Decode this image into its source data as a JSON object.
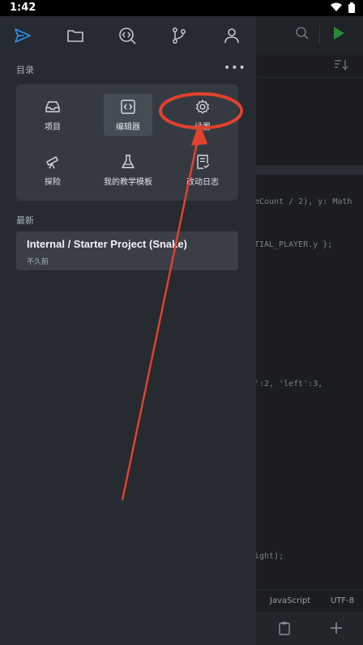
{
  "status_bar": {
    "time": "1:42"
  },
  "drawer": {
    "nav": [
      "send-icon",
      "folder-icon",
      "search-code-icon",
      "branch-icon",
      "user-icon"
    ],
    "section_title": "目录",
    "more_label": "•••",
    "menu": [
      {
        "label": "项目",
        "icon": "inbox-icon"
      },
      {
        "label": "编辑器",
        "icon": "code-icon",
        "active": true
      },
      {
        "label": "设置",
        "icon": "gear-icon"
      },
      {
        "label": "探险",
        "icon": "telescope-icon"
      },
      {
        "label": "我的教学模板",
        "icon": "flask-icon"
      },
      {
        "label": "改动日志",
        "icon": "changelog-icon"
      }
    ],
    "recent_title": "最新",
    "recent": {
      "name": "Internal / Starter Project (Snake)",
      "time": "不久前"
    }
  },
  "editor": {
    "code_lines": [
      "eCount / 2), y: Math",
      "TIAL_PLAYER.y };",
      "':2, 'left':3,",
      "ight);"
    ],
    "status_language": "JavaScript",
    "status_encoding": "UTF-8"
  },
  "colors": {
    "accent": "#2f8df5",
    "play": "#2ea043",
    "annotation": "#e0422e"
  }
}
